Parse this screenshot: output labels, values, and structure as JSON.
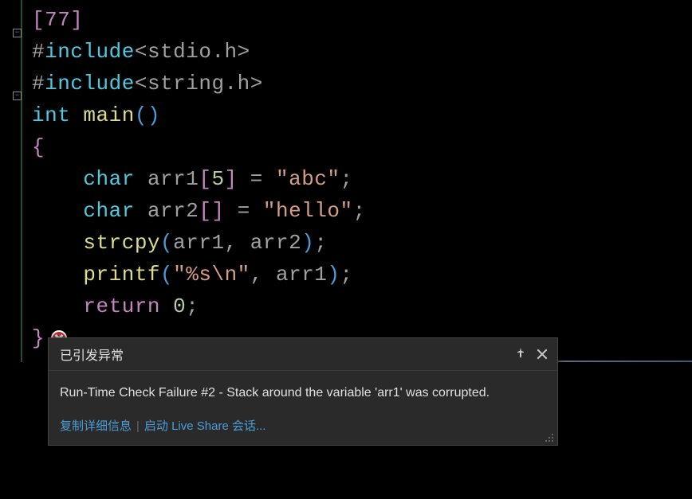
{
  "code": {
    "line1": "[77]",
    "include1": {
      "hash": "#",
      "kw": "include",
      "open": "<",
      "header": "stdio.h",
      "close": ">"
    },
    "include2": {
      "hash": "#",
      "kw": "include",
      "open": "<",
      "header": "string.h",
      "close": ">"
    },
    "main_decl": {
      "type": "int",
      "name": "main",
      "parens": "()"
    },
    "open_brace": "{",
    "decl1": {
      "type": "char",
      "var": "arr1",
      "size": "5",
      "eq": " = ",
      "str": "\"abc\""
    },
    "decl2": {
      "type": "char",
      "var": "arr2",
      "brackets": "[]",
      "eq": " = ",
      "str": "\"hello\""
    },
    "strcpy": {
      "fn": "strcpy",
      "arg1": "arr1",
      "arg2": "arr2"
    },
    "printf": {
      "fn": "printf",
      "fmt": "\"%s\\n\"",
      "arg": "arr1"
    },
    "return": {
      "kw": "return",
      "val": "0"
    },
    "close_brace": "}"
  },
  "popup": {
    "title": "已引发异常",
    "message": "Run-Time Check Failure #2 - Stack around the variable 'arr1' was corrupted.",
    "link1": "复制详细信息",
    "link2": "启动 Live Share 会话..."
  }
}
